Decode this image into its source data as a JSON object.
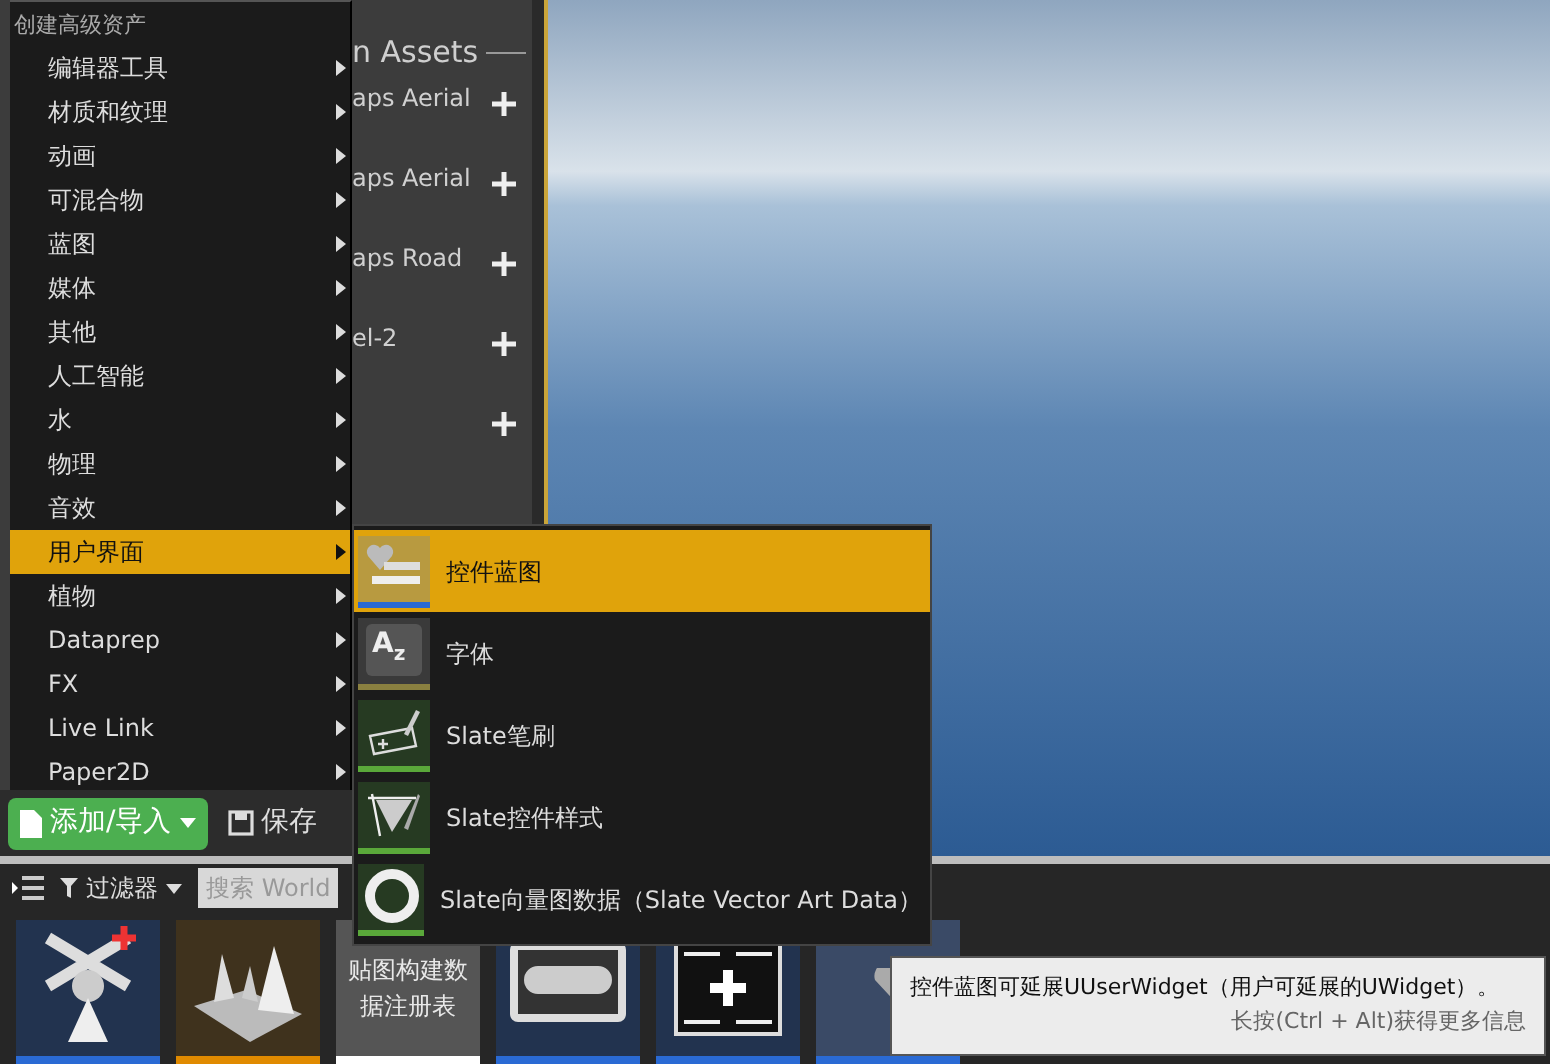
{
  "assets_panel": {
    "heading": "n Assets",
    "items": [
      {
        "kind": "named",
        "name": "aps Aerial"
      },
      {
        "kind": "named",
        "name": "aps Aerial"
      },
      {
        "kind": "named",
        "name": "aps Road"
      },
      {
        "kind": "named",
        "name": "el-2"
      },
      {
        "kind": "blank"
      }
    ]
  },
  "toolbar": {
    "add_button": "添加/导入",
    "save_button": "保存"
  },
  "filter_bar": {
    "filter_button": "过滤器",
    "search": {
      "placeholder": "搜索 World"
    }
  },
  "tiles": [
    {
      "kind": "actor",
      "color": "#2a6ad4"
    },
    {
      "kind": "landscape",
      "color": "#e08a00"
    },
    {
      "kind": "text",
      "label": "贴图构建数据注册表",
      "color": "#ffffff"
    },
    {
      "kind": "gamepad",
      "color": "#2a6ad4"
    },
    {
      "kind": "widget",
      "color": "#2a6ad4"
    },
    {
      "kind": "heart",
      "color": "#2a6ad4"
    }
  ],
  "menu": {
    "header": "创建高级资产",
    "items": [
      {
        "label": "编辑器工具",
        "selected": false
      },
      {
        "label": "材质和纹理",
        "selected": false
      },
      {
        "label": "动画",
        "selected": false
      },
      {
        "label": "可混合物",
        "selected": false
      },
      {
        "label": "蓝图",
        "selected": false
      },
      {
        "label": "媒体",
        "selected": false
      },
      {
        "label": "其他",
        "selected": false
      },
      {
        "label": "人工智能",
        "selected": false
      },
      {
        "label": "水",
        "selected": false
      },
      {
        "label": "物理",
        "selected": false
      },
      {
        "label": "音效",
        "selected": false
      },
      {
        "label": "用户界面",
        "selected": true
      },
      {
        "label": "植物",
        "selected": false
      },
      {
        "label": "Dataprep",
        "selected": false
      },
      {
        "label": "FX",
        "selected": false
      },
      {
        "label": "Live Link",
        "selected": false
      },
      {
        "label": "Paper2D",
        "selected": false
      }
    ]
  },
  "submenu": {
    "items": [
      {
        "label": "控件蓝图",
        "kind": "widget",
        "color": "#2a6ad4",
        "selected": true
      },
      {
        "label": "字体",
        "kind": "font",
        "icon_letters": [
          "A",
          "z"
        ],
        "color": "#8a8040",
        "selected": false
      },
      {
        "label": "Slate笔刷",
        "kind": "brush",
        "color": "#5aa83a",
        "selected": false
      },
      {
        "label": "Slate控件样式",
        "kind": "style",
        "color": "#5aa83a",
        "selected": false
      },
      {
        "label": "Slate向量图数据（Slate Vector Art Data）",
        "kind": "vector",
        "color": "#5aa83a",
        "selected": false
      }
    ]
  },
  "tooltip": {
    "text": "控件蓝图可延展UUserWidget（用户可延展的UWidget）。",
    "hint": "长按(Ctrl + Alt)获得更多信息"
  }
}
